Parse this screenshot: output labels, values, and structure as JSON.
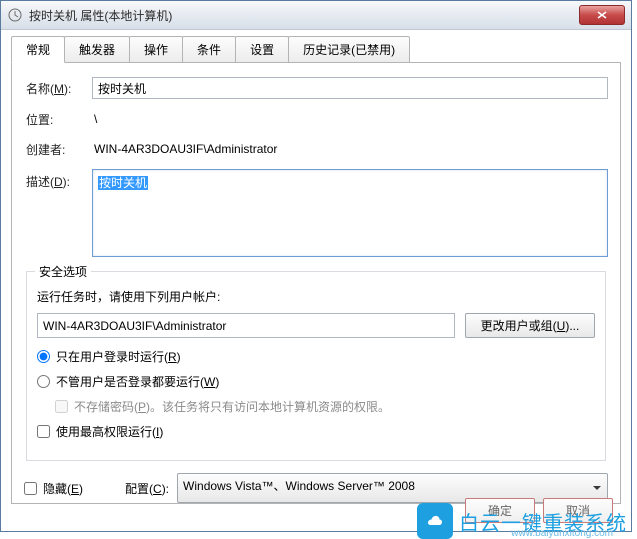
{
  "window": {
    "title": "按时关机 属性(本地计算机)"
  },
  "tabs": {
    "items": [
      {
        "label": "常规"
      },
      {
        "label": "触发器"
      },
      {
        "label": "操作"
      },
      {
        "label": "条件"
      },
      {
        "label": "设置"
      },
      {
        "label": "历史记录(已禁用)"
      }
    ],
    "active_index": 0
  },
  "general": {
    "name_label": "名称(M):",
    "name_value": "按时关机",
    "location_label": "位置:",
    "location_value": "\\",
    "creator_label": "创建者:",
    "creator_value": "WIN-4AR3DOAU3IF\\Administrator",
    "desc_label": "描述(D):",
    "desc_value": "按时关机"
  },
  "security": {
    "legend": "安全选项",
    "prompt": "运行任务时，请使用下列用户帐户:",
    "account": "WIN-4AR3DOAU3IF\\Administrator",
    "change_btn": "更改用户或组(U)...",
    "radio_logged_on": "只在用户登录时运行(R)",
    "radio_any": "不管用户是否登录都要运行(W)",
    "no_store_pwd": "不存储密码(P)。该任务将只有访问本地计算机资源的权限。",
    "highest_priv": "使用最高权限运行(I)"
  },
  "bottom": {
    "hidden_label": "隐藏(E)",
    "config_label": "配置(C):",
    "config_value": "Windows Vista™、Windows Server™ 2008"
  },
  "buttons": {
    "ok": "确定",
    "cancel": "取消"
  },
  "watermark": {
    "text": "白云一键重装系统",
    "url": "www.baiyunxitong.com"
  }
}
